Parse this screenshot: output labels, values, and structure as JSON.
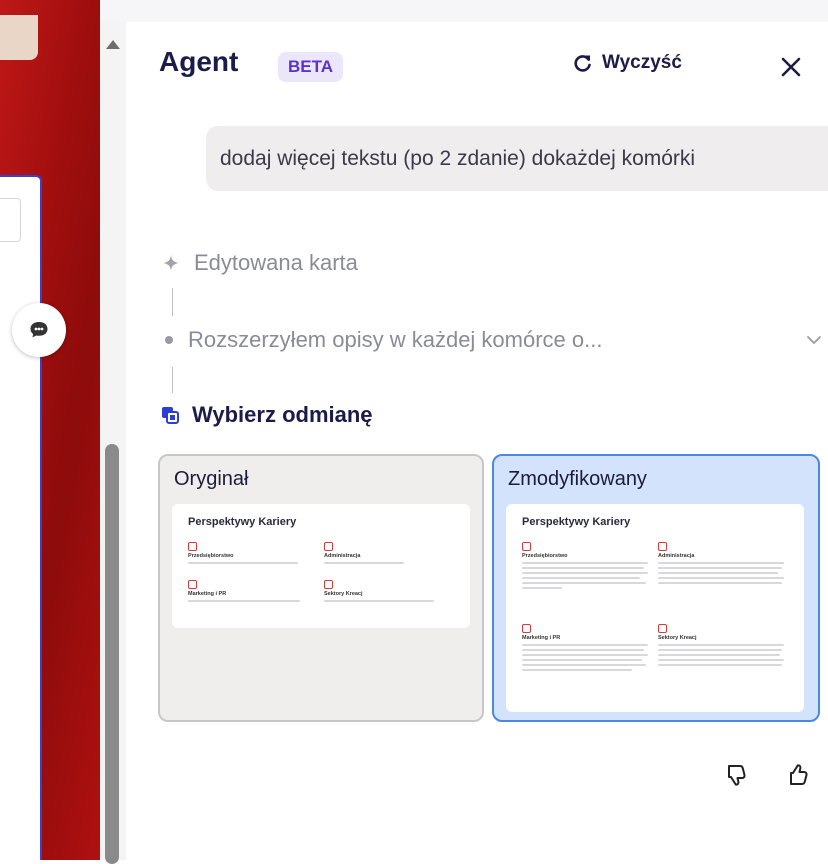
{
  "panel": {
    "title": "Agent",
    "badge": "BETA",
    "clear_label": "Wyczyść",
    "close_icon": "close-icon",
    "user_message": "dodaj więcej tekstu (po 2 zdanie) dokażdej komórki",
    "steps": [
      {
        "icon": "sparkle-icon",
        "label": "Edytowana karta"
      },
      {
        "icon": "dot-icon",
        "label": "Rozszerzyłem opisy w każdej komórce o..."
      }
    ],
    "choose_label": "Wybierz odmianę",
    "variants": [
      {
        "title": "Oryginał",
        "selected": false
      },
      {
        "title": "Zmodyfikowany",
        "selected": true
      }
    ],
    "preview": {
      "title": "Perspektywy Kariery",
      "items": [
        "Przedsiębiorstwo",
        "Administracja",
        "Marketing i PR",
        "Sektory Kreacj"
      ]
    },
    "feedback": [
      "thumbs-down-icon",
      "thumbs-up-icon"
    ]
  },
  "colors": {
    "accent": "#4b88e6",
    "badge_bg": "#ece6fb",
    "badge_text": "#5b33c9",
    "canvas_red": "#a00e0e"
  }
}
